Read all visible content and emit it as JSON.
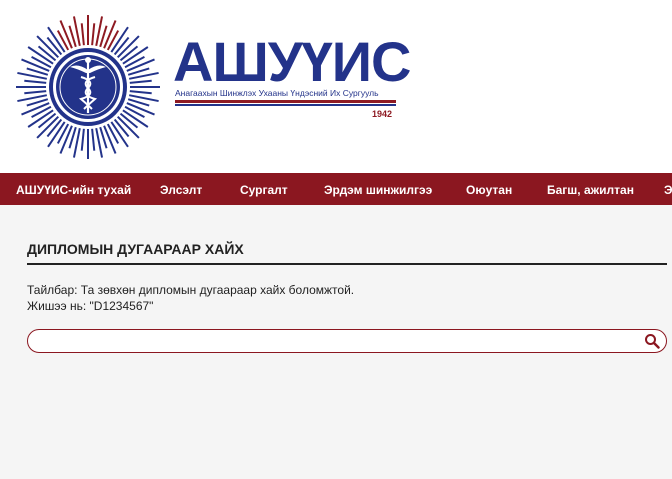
{
  "brand": {
    "title": "АШУҮИС",
    "subtitle": "Анагаахын Шинжлэх Ухааны Үндэсний Их Сургууль",
    "year": "1942",
    "colors": {
      "blue": "#23338a",
      "red": "#8e1a22"
    }
  },
  "nav": {
    "items": [
      {
        "label": "АШУҮИС-ийн тухай"
      },
      {
        "label": "Элсэлт"
      },
      {
        "label": "Сургалт"
      },
      {
        "label": "Эрдэм шинжилгээ"
      },
      {
        "label": "Оюутан"
      },
      {
        "label": "Багш, ажилтан"
      },
      {
        "label": "Э"
      }
    ],
    "background": "#8b1720"
  },
  "main": {
    "title": "ДИПЛОМЫН ДУГААРААР ХАЙХ",
    "note_line1": "Тайлбар: Та зөвхөн дипломын дугаараар хайх боломжтой.",
    "note_line2": "Жишээ нь: \"D1234567\""
  },
  "search": {
    "value": "",
    "placeholder": "",
    "icon": "search-icon"
  }
}
